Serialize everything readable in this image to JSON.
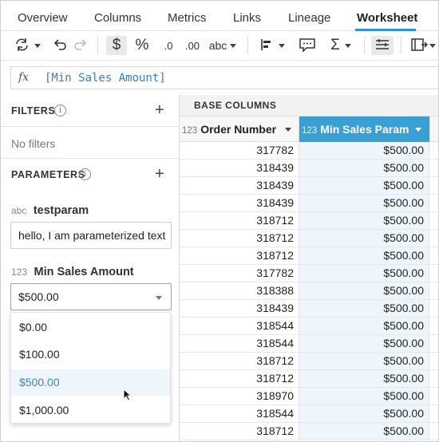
{
  "tabs": [
    {
      "label": "Overview"
    },
    {
      "label": "Columns"
    },
    {
      "label": "Metrics"
    },
    {
      "label": "Links"
    },
    {
      "label": "Lineage"
    },
    {
      "label": "Worksheet",
      "active": true
    }
  ],
  "toolbar": {
    "items": [
      "refresh-icon",
      "undo-icon",
      "redo-icon",
      "dollar-format-icon",
      "percent-format-icon",
      "decrease-decimals-icon",
      "increase-decimals-icon",
      "text-format-icon",
      "align-icon",
      "comment-icon",
      "sum-icon",
      "row-density-icon",
      "export-icon"
    ],
    "dollar": "$",
    "percent": "%",
    "dec_less": ".0",
    "dec_more": ".00",
    "text_format": "abc",
    "sigma": "Σ"
  },
  "formula": {
    "fx": "fx",
    "text": "[Min Sales Amount]"
  },
  "filters": {
    "title": "FILTERS",
    "empty_text": "No filters"
  },
  "parameters": {
    "title": "PARAMETERS",
    "items": [
      {
        "type": "abc",
        "name": "testparam",
        "value": "hello, I am parameterized text"
      },
      {
        "type": "123",
        "name": "Min Sales Amount",
        "value": "$500.00"
      }
    ]
  },
  "dropdown": {
    "options": [
      "$0.00",
      "$100.00",
      "$500.00",
      "$1,000.00"
    ],
    "selected_index": 2
  },
  "grid": {
    "section_title": "BASE COLUMNS",
    "columns": [
      {
        "type": "123",
        "name": "Order Number"
      },
      {
        "type": "123",
        "name": "Min Sales Param"
      }
    ],
    "rows": [
      [
        "317782",
        "$500.00"
      ],
      [
        "318439",
        "$500.00"
      ],
      [
        "318439",
        "$500.00"
      ],
      [
        "318439",
        "$500.00"
      ],
      [
        "318712",
        "$500.00"
      ],
      [
        "318712",
        "$500.00"
      ],
      [
        "318712",
        "$500.00"
      ],
      [
        "317782",
        "$500.00"
      ],
      [
        "318388",
        "$500.00"
      ],
      [
        "318439",
        "$500.00"
      ],
      [
        "318544",
        "$500.00"
      ],
      [
        "318544",
        "$500.00"
      ],
      [
        "318712",
        "$500.00"
      ],
      [
        "318712",
        "$500.00"
      ],
      [
        "318970",
        "$500.00"
      ],
      [
        "318544",
        "$500.00"
      ],
      [
        "318712",
        "$500.00"
      ]
    ]
  },
  "colors": {
    "accent": "#3a9fd3",
    "selected_column_bg": "#eef6fc",
    "formula_text": "#3b7fc0"
  }
}
